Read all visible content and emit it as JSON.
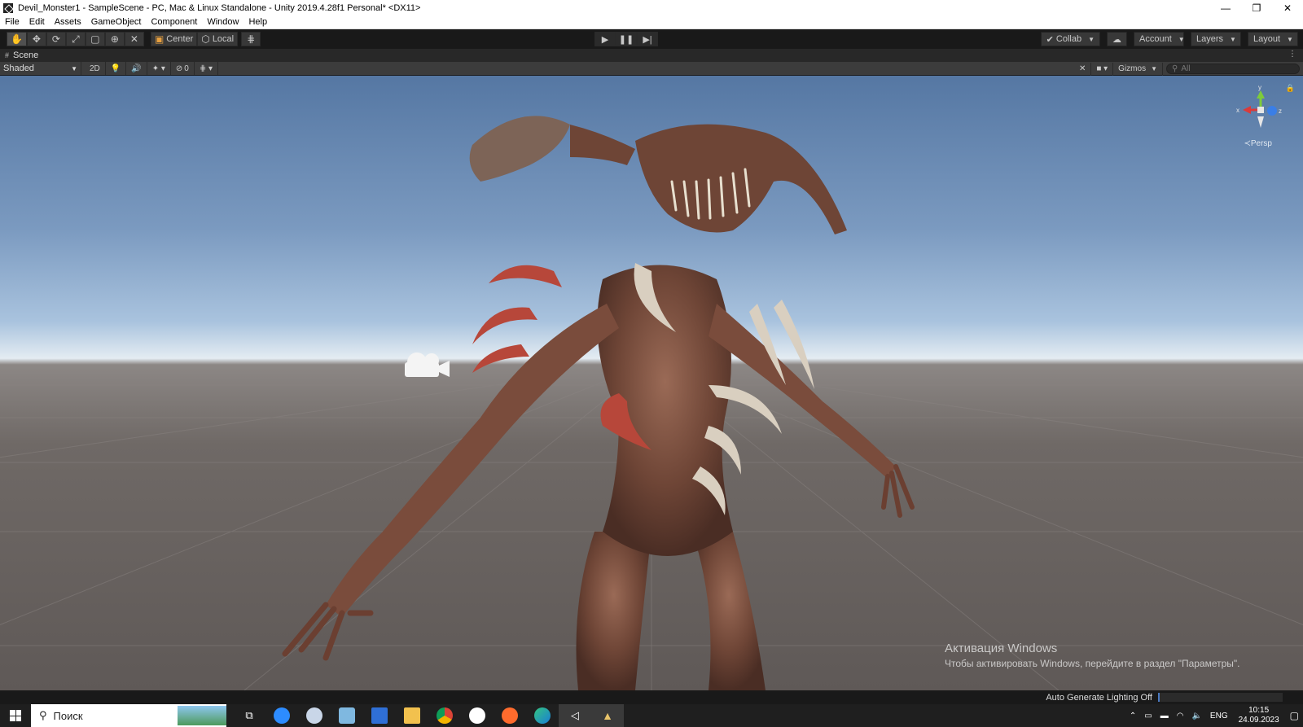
{
  "window": {
    "title": "Devil_Monster1 - SampleScene - PC, Mac & Linux Standalone - Unity 2019.4.28f1 Personal* <DX11>",
    "controls": [
      "—",
      "❐",
      "✕"
    ]
  },
  "menu": [
    "File",
    "Edit",
    "Assets",
    "GameObject",
    "Component",
    "Window",
    "Help"
  ],
  "toolbar": {
    "pivot_label": "Center",
    "space_label": "Local",
    "collab_label": "Collab",
    "account_label": "Account",
    "layers_label": "Layers",
    "layout_label": "Layout"
  },
  "scene_tab": {
    "label": "Scene"
  },
  "scene_toolbar": {
    "draw_mode": "Shaded",
    "mode_2d": "2D",
    "hidden_count": "0",
    "gizmos_label": "Gizmos",
    "search_placeholder": "All"
  },
  "viewport": {
    "projection_label": "Persp",
    "axis_labels": {
      "x": "x",
      "y": "y",
      "z": "z"
    },
    "colors": {
      "x_axis": "#d93b3b",
      "y_axis": "#7ecb3a",
      "z_axis": "#3a7ee6"
    }
  },
  "watermark": {
    "line1": "Активация Windows",
    "line2": "Чтобы активировать Windows, перейдите в раздел \"Параметры\"."
  },
  "status": {
    "text": "Auto Generate Lighting Off"
  },
  "taskbar": {
    "search_text": "Поиск",
    "language": "ENG",
    "time": "10:15",
    "date": "24.09.2023"
  }
}
